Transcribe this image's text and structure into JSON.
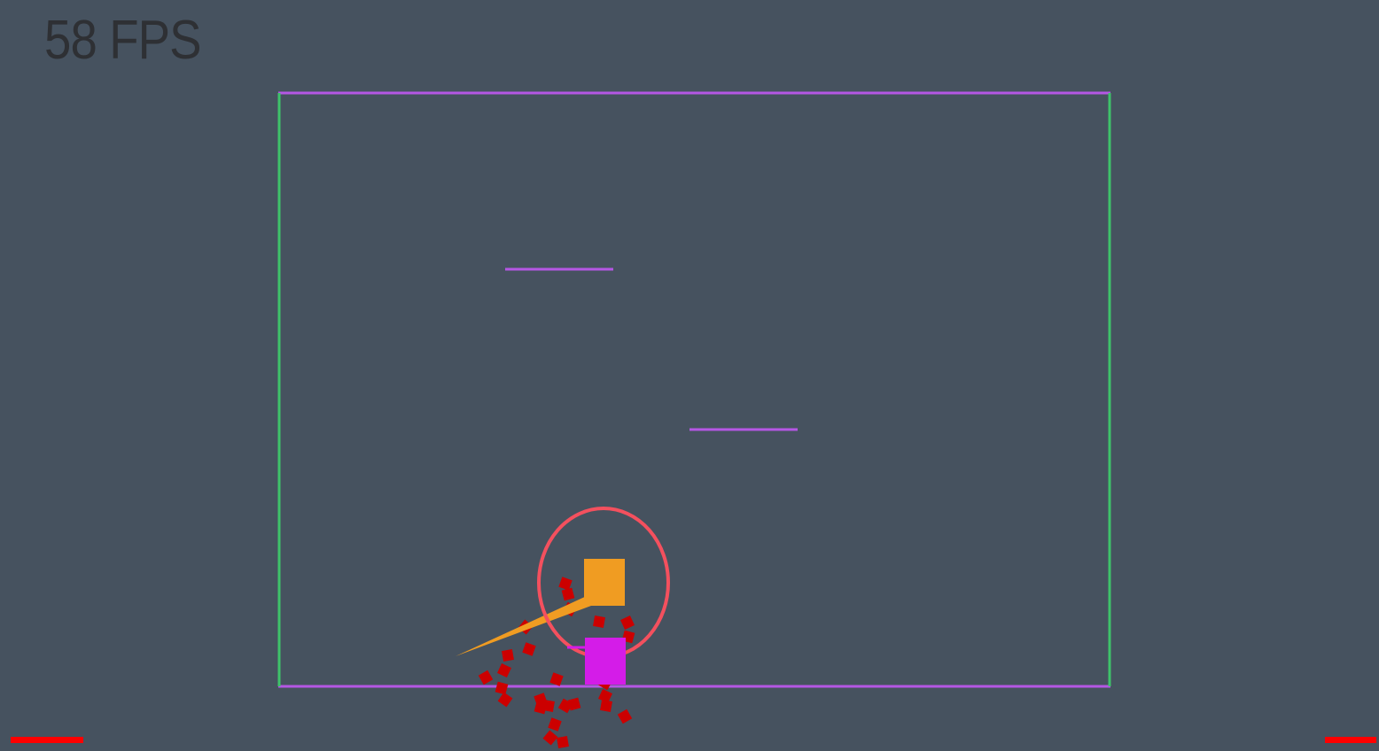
{
  "hud": {
    "fps_text": "58 FPS"
  },
  "colors": {
    "background": "#46525f",
    "wall_horizontal": "#b557e4",
    "wall_vertical": "#3ec36a",
    "ring": "#f4505e",
    "enemy": "#f09c22",
    "player": "#d41ce8",
    "particle": "#cc0000",
    "health_bar": "#ff0000"
  },
  "entities": {
    "arena": "arena-boundary",
    "platforms": [
      "platform-upper",
      "platform-middle"
    ],
    "enemy": "enemy-square",
    "player": "player-square",
    "ring": "target-ring",
    "beam": "laser-beam",
    "health_bars": [
      "health-bar-left",
      "health-bar-right"
    ]
  }
}
